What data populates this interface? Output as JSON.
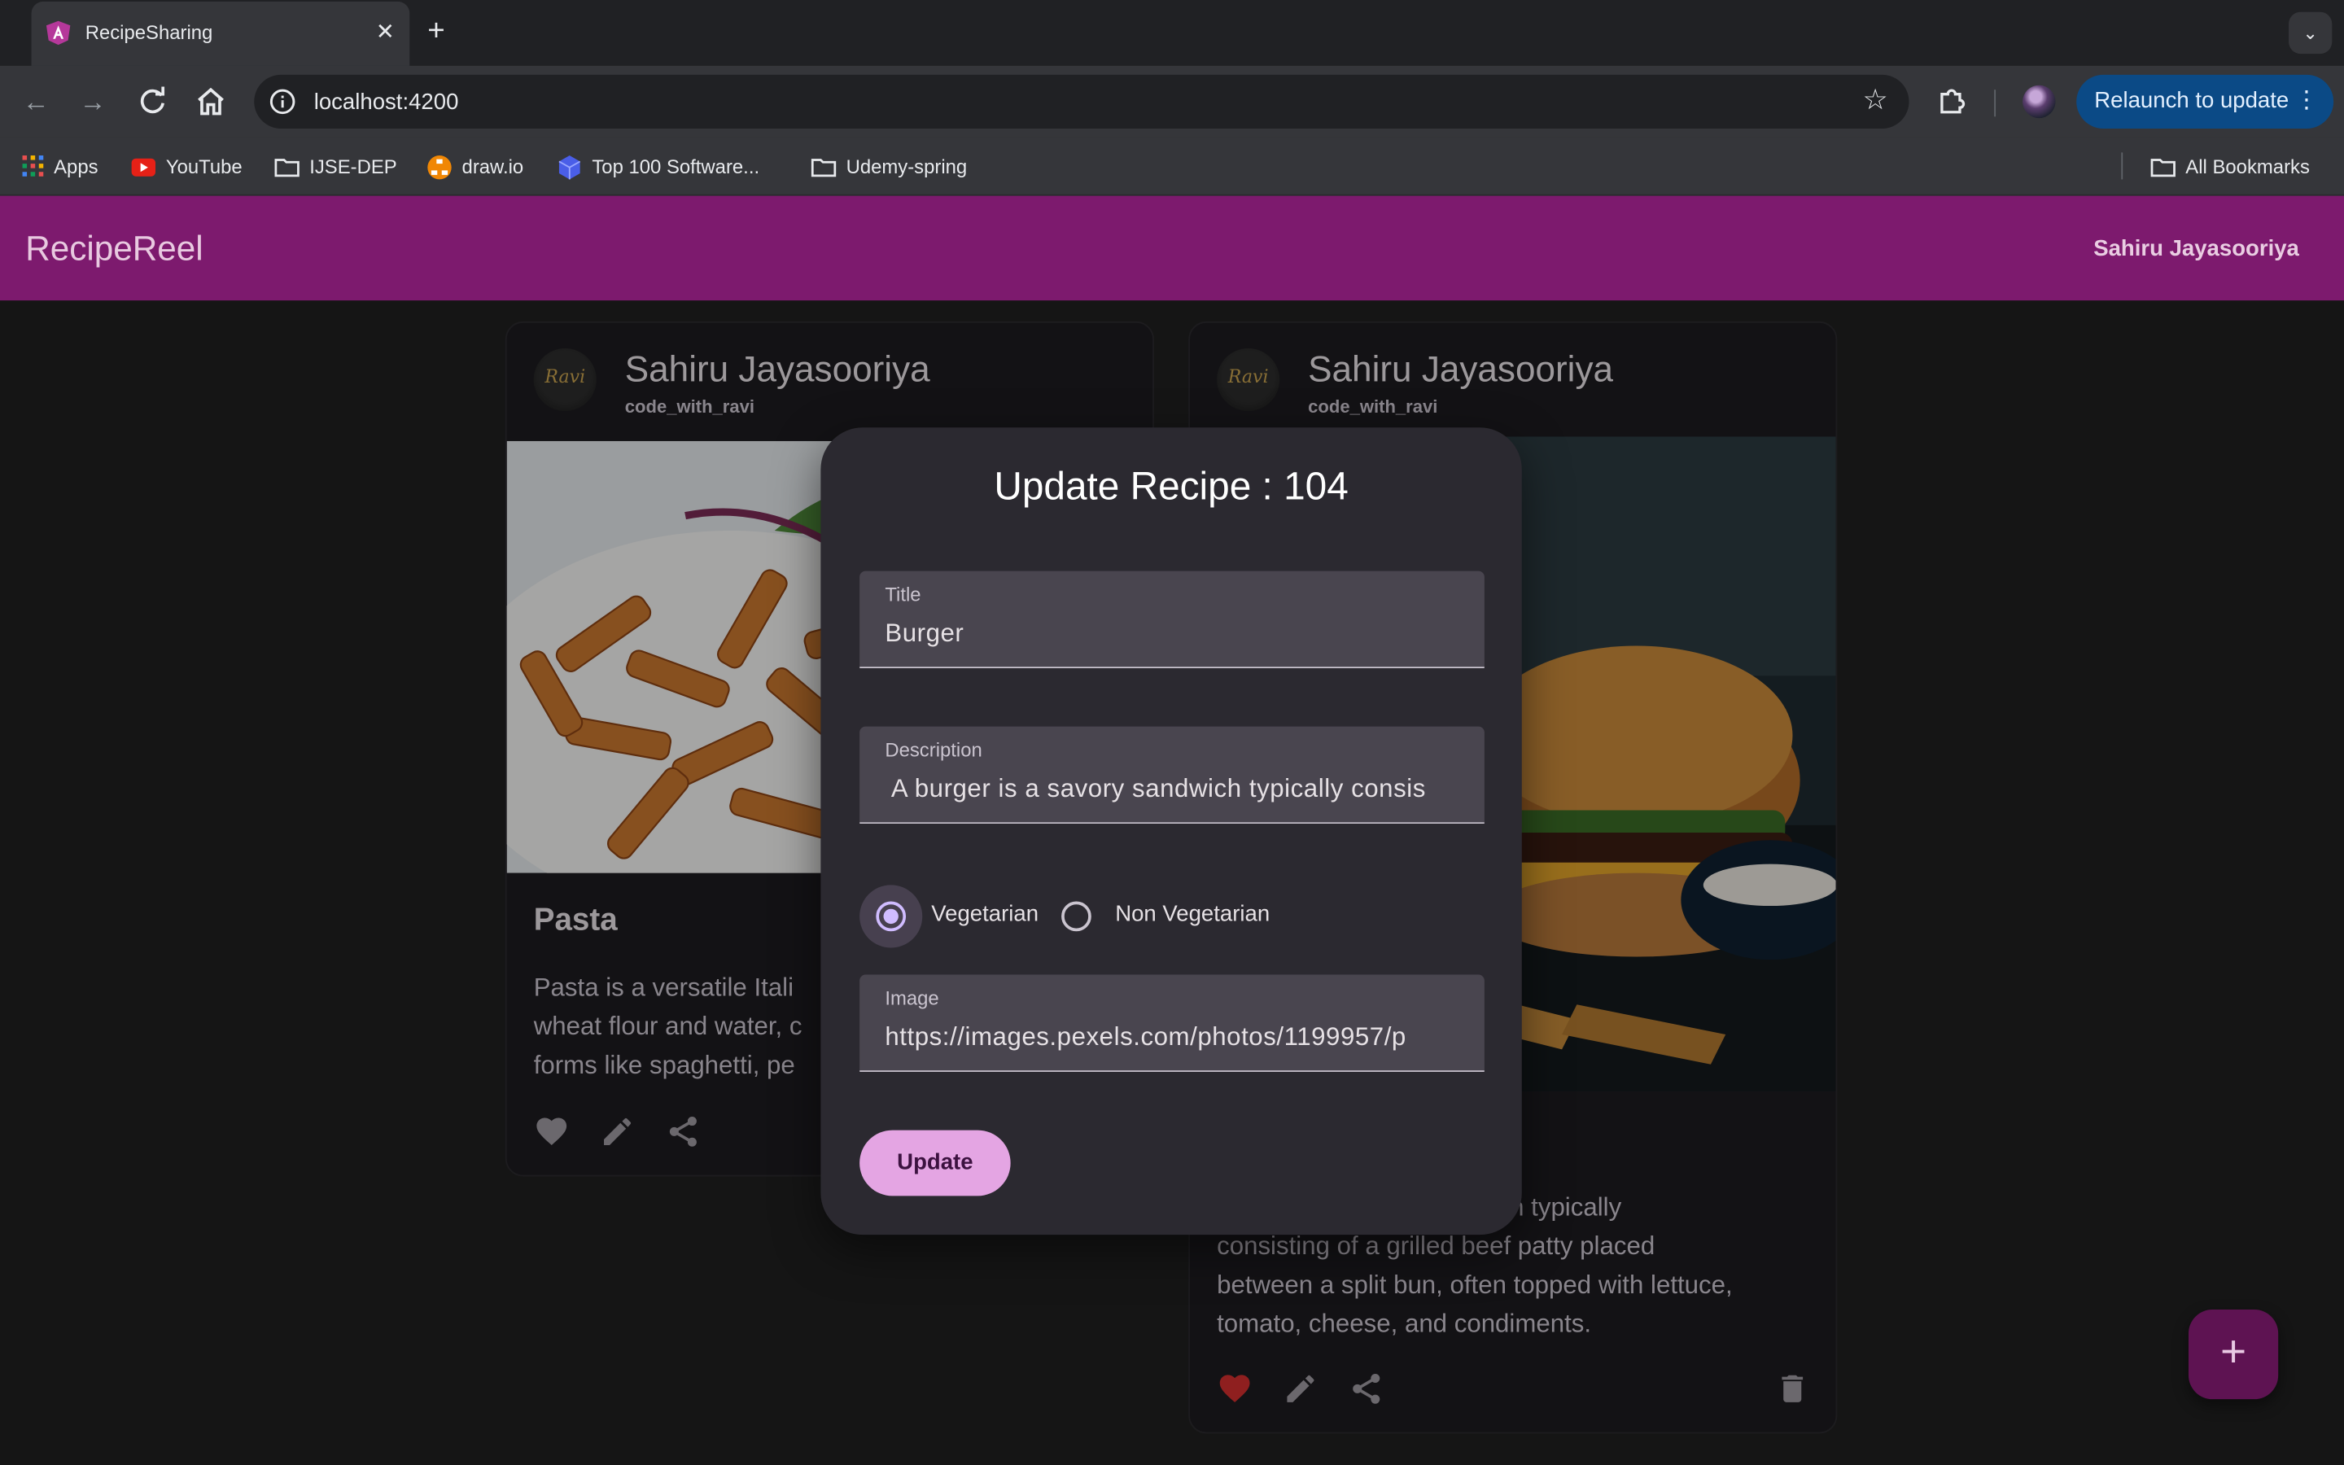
{
  "browser": {
    "tab_title": "RecipeSharing",
    "url": "localhost:4200",
    "relaunch_label": "Relaunch to update",
    "bookmarks": [
      "Apps",
      "YouTube",
      "IJSE-DEP",
      "draw.io",
      "Top 100 Software...",
      "Udemy-spring"
    ],
    "all_bookmarks": "All Bookmarks"
  },
  "app": {
    "brand": "RecipeReel",
    "user_name": "Sahiru Jayasooriya"
  },
  "cards": [
    {
      "author": "Sahiru Jayasooriya",
      "handle": "code_with_ravi",
      "avatar_text": "Ravi",
      "title": "Pasta",
      "description_lines": [
        "Pasta is a versatile Itali",
        "wheat flour and water, c",
        "forms like spaghetti, pe"
      ],
      "liked": false
    },
    {
      "author": "Sahiru Jayasooriya",
      "handle": "code_with_ravi",
      "avatar_text": "Ravi",
      "description_lines": [
        "dwich typically",
        "consisting of a grilled beef patty placed",
        "between a split bun, often topped with lettuce,",
        "tomato, cheese, and condiments."
      ],
      "liked": true
    }
  ],
  "dialog": {
    "title": "Update Recipe : 104",
    "title_label": "Title",
    "title_value": "Burger",
    "description_label": "Description",
    "description_value": " A burger is a savory sandwich typically consis",
    "radio_options": [
      "Vegetarian",
      "Non Vegetarian"
    ],
    "radio_selected": "Vegetarian",
    "image_label": "Image",
    "image_value": "https://images.pexels.com/photos/1199957/p",
    "update_label": "Update"
  },
  "fab_label": "+",
  "colors": {
    "appbar": "#7d1a6e",
    "dialog_bg": "#2b2930",
    "primary_button": "#e4a5e3",
    "fab": "#5e1352",
    "liked_heart": "#d32f2f",
    "relaunch": "#0b4a86"
  }
}
